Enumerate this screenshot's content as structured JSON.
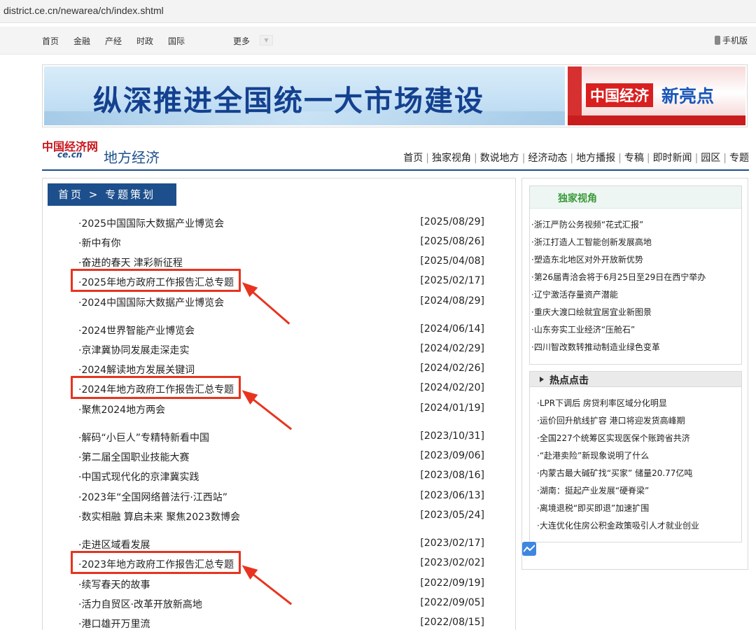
{
  "browser": {
    "url": "district.ce.cn/newarea/ch/index.shtml"
  },
  "topnav": {
    "items": [
      "首页",
      "金融",
      "产经",
      "时政",
      "国际"
    ],
    "more": "更多",
    "mobile": "手机版"
  },
  "banner": {
    "slogan": "纵深推进全国统一大市场建设",
    "brand": "中国经济",
    "bright": "新亮点"
  },
  "site": {
    "logo_cn": "中国经济网",
    "logo_en": "ce.cn",
    "name": "地方经济",
    "nav": [
      "首页",
      "独家视角",
      "数说地方",
      "经济动态",
      "地方播报",
      "专稿",
      "即时新闻",
      "园区",
      "专题"
    ]
  },
  "breadcrumb": "首页 > 专题策划",
  "topics": [
    {
      "title": "·2025中国国际大数据产业博览会",
      "date": "[2025/08/29]"
    },
    {
      "title": "·新中有你",
      "date": "[2025/08/26]"
    },
    {
      "title": "·奋进的春天 津彩新征程",
      "date": "[2025/04/08]"
    },
    {
      "title": "·2025年地方政府工作报告汇总专题",
      "date": "[2025/02/17]"
    },
    {
      "title": "·2024中国国际大数据产业博览会",
      "date": "[2024/08/29]"
    },
    {
      "title": "·2024世界智能产业博览会",
      "date": "[2024/06/14]"
    },
    {
      "title": "·京津冀协同发展走深走实",
      "date": "[2024/02/29]"
    },
    {
      "title": "·2024解读地方发展关键词",
      "date": "[2024/02/26]"
    },
    {
      "title": "·2024年地方政府工作报告汇总专题",
      "date": "[2024/02/20]"
    },
    {
      "title": "·聚焦2024地方两会",
      "date": "[2024/01/19]"
    },
    {
      "title": "·解码“小巨人”专精特新看中国",
      "date": "[2023/10/31]"
    },
    {
      "title": "·第二届全国职业技能大赛",
      "date": "[2023/09/06]"
    },
    {
      "title": "·中国式现代化的京津冀实践",
      "date": "[2023/08/16]"
    },
    {
      "title": "·2023年“全国网络普法行·江西站”",
      "date": "[2023/06/13]"
    },
    {
      "title": "·数实相融 算启未来 聚焦2023数博会",
      "date": "[2023/05/24]"
    },
    {
      "title": "·走进区域看发展",
      "date": "[2023/02/17]"
    },
    {
      "title": "·2023年地方政府工作报告汇总专题",
      "date": "[2023/02/02]"
    },
    {
      "title": "·续写春天的故事",
      "date": "[2022/09/19]"
    },
    {
      "title": "·活力自贸区·改革开放新高地",
      "date": "[2022/09/05]"
    },
    {
      "title": "·港口雄开万里流",
      "date": "[2022/08/15]"
    }
  ],
  "exclusive": {
    "title": "独家视角",
    "items": [
      "·浙江严防公务视频“花式汇报”",
      "·浙江打造人工智能创新发展高地",
      "·塑造东北地区对外开放新优势",
      "·第26届青洽会将于6月25日至29日在西宁举办",
      "·辽宁激活存量资产潜能",
      "·重庆大渡口绘就宜居宜业新图景",
      "·山东夯实工业经济“压舱石”",
      "·四川智改数转推动制造业绿色变革"
    ]
  },
  "hot": {
    "title": "热点点击",
    "items": [
      "·LPR下调后 房贷利率区域分化明显",
      "·运价回升航线扩容 港口将迎发货高峰期",
      "·全国227个统筹区实现医保个账跨省共济",
      "·“赴港卖险”新现象说明了什么",
      "·内蒙古最大碱矿找“买家” 储量20.77亿吨",
      "·湖南：挺起产业发展“硬脊梁”",
      "·离境退税“即买即退”加速扩围",
      "·大连优化住房公积金政策吸引人才就业创业"
    ]
  },
  "colors": {
    "nav_blue": "#1d4f8c",
    "highlight_red": "#e8341f",
    "brand_red": "#c8161d"
  }
}
